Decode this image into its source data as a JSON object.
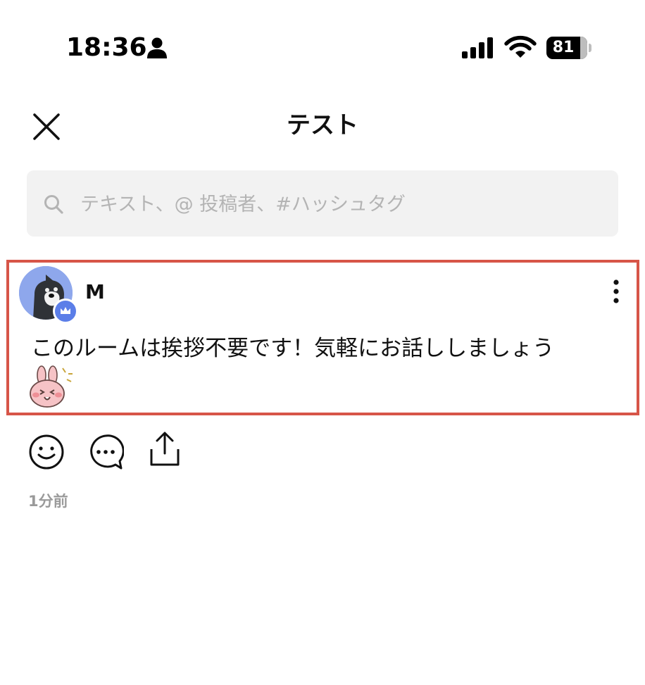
{
  "status_bar": {
    "time": "18:36",
    "battery": "81"
  },
  "header": {
    "title": "テスト"
  },
  "search": {
    "placeholder": "テキスト、@ 投稿者、#ハッシュタグ"
  },
  "post": {
    "author": "M",
    "text": "このルームは挨拶不要です！気軽にお話ししましょう",
    "timestamp": "1分前"
  },
  "icons": {
    "close": "close-icon",
    "search": "search-icon",
    "more": "more-vertical-icon",
    "reaction": "smile-icon",
    "comment": "comment-icon",
    "share": "share-icon"
  },
  "colors": {
    "highlight_border": "#d75548",
    "avatar_bg": "#8ea7ec",
    "admin_badge": "#5b7ee8",
    "search_bg": "#f2f2f2"
  }
}
